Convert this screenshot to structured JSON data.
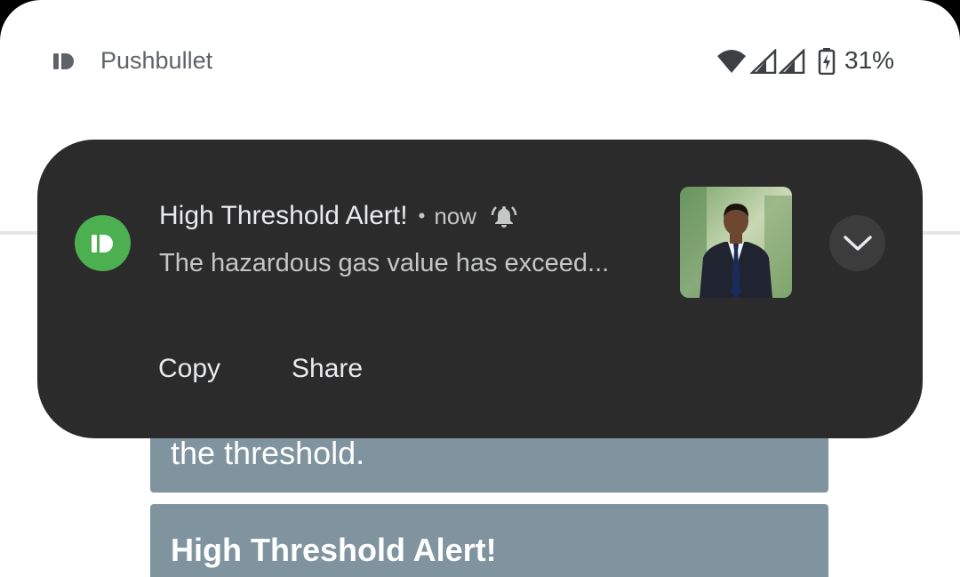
{
  "status_bar": {
    "app_name": "Pushbullet",
    "battery": "31%"
  },
  "notification": {
    "title": "High Threshold Alert!",
    "separator": "•",
    "time": "now",
    "body": "The hazardous gas value has exceed...",
    "actions": {
      "copy": "Copy",
      "share": "Share"
    },
    "accent_color": "#4caf50"
  },
  "background_messages": {
    "card1_text": "the threshold.",
    "card2_title": "High Threshold Alert!"
  },
  "icons": {
    "app_icon": "pushbullet-icon",
    "wifi": "wifi-icon",
    "signal": "signal-icon",
    "battery": "battery-charging-icon",
    "bell": "bell-icon",
    "expand": "chevron-down-icon"
  }
}
